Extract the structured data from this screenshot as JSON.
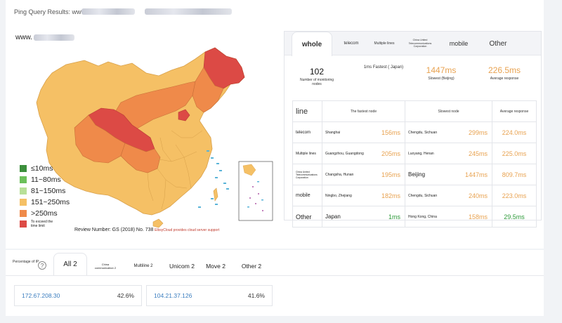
{
  "header": {
    "title": "Ping Query Results: www."
  },
  "map": {
    "domain_prefix": "www.",
    "review_number": "Review Number: GS (2018) No. 738",
    "cloud_note": "ElbsyCloud provides cloud server support",
    "colors": {
      "fast": "#3c8f3c",
      "good": "#6cc05a",
      "mid": "#b8e098",
      "slow": "#f5c065",
      "slower": "#ef8a4a",
      "timeout": "#dc4a45"
    },
    "legend": [
      {
        "label": "≤10ms",
        "color": "#3c8f3c"
      },
      {
        "label": "11~80ms",
        "color": "#6cc05a"
      },
      {
        "label": "81~150ms",
        "color": "#b8e098"
      },
      {
        "label": "151~250ms",
        "color": "#f5c065"
      },
      {
        "label": ">250ms",
        "color": "#ef8a4a"
      },
      {
        "label": "To exceed the time limit",
        "color": "#dc4a45"
      }
    ]
  },
  "tabs": [
    {
      "label": "whole"
    },
    {
      "label": "telecom"
    },
    {
      "label": "Multiple lines"
    },
    {
      "label": "China United Telecommunications Corporation"
    },
    {
      "label": "mobile"
    },
    {
      "label": "Other"
    }
  ],
  "stats": {
    "nodes": {
      "value": "102",
      "label": "Number of monitoring nodes"
    },
    "fastest": {
      "value": "1ms Fastest ( Japan)"
    },
    "slowest": {
      "value": "1447ms",
      "label": "Slowest (Beijing)"
    },
    "average": {
      "value": "226.5ms",
      "label": "Average response"
    }
  },
  "table": {
    "headers": [
      "line",
      "The fastest node",
      "Slowest node",
      "Average response"
    ],
    "rows": [
      {
        "line": "telecom",
        "fast_node": "Shanghai",
        "fast_ms": "156ms",
        "slow_node": "Chengdu, Sichuan",
        "slow_ms": "299ms",
        "avg": "224.0ms"
      },
      {
        "line": "Multiple lines",
        "fast_node": "Guangzhou, Guangdong",
        "fast_ms": "205ms",
        "slow_node": "Luoyang, Henan",
        "slow_ms": "245ms",
        "avg": "225.0ms"
      },
      {
        "line": "China United Telecommunications Corporation",
        "fast_node": "Changsha, Hunan",
        "fast_ms": "195ms",
        "slow_node": "Beijing",
        "slow_ms": "1447ms",
        "avg": "809.7ms"
      },
      {
        "line": "mobile",
        "fast_node": "Ningbo, Zhejiang",
        "fast_ms": "182ms",
        "slow_node": "Chengdu, Sichuan",
        "slow_ms": "240ms",
        "avg": "223.0ms"
      },
      {
        "line": "Other",
        "fast_node": "Japan",
        "fast_ms": "1ms",
        "slow_node": "Hong Kong, China",
        "slow_ms": "158ms",
        "avg": "29.5ms"
      }
    ]
  },
  "bottom": {
    "label": "Percentage of IP:",
    "help": "?",
    "tabs": [
      {
        "label": "All 2"
      },
      {
        "label": "China communication 2"
      },
      {
        "label": "Multiline 2"
      },
      {
        "label": "Unicom 2"
      },
      {
        "label": "Move 2"
      },
      {
        "label": "Other 2"
      }
    ],
    "ips": [
      {
        "ip": "172.67.208.30",
        "pct": "42.6%"
      },
      {
        "ip": "104.21.37.126",
        "pct": "41.6%"
      }
    ]
  }
}
